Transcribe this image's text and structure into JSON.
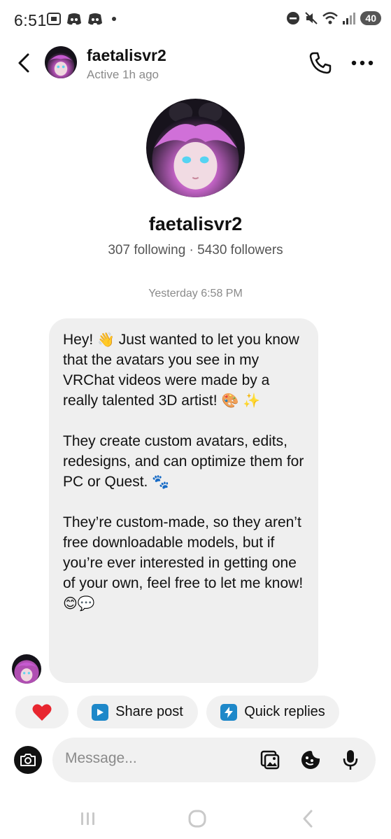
{
  "status_bar": {
    "time": "6:51",
    "battery": "40"
  },
  "header": {
    "username": "faetalisvr2",
    "active_status": "Active 1h ago"
  },
  "profile": {
    "username": "faetalisvr2",
    "stats": "307 following · 5430 followers"
  },
  "conversation": {
    "timestamp": "Yesterday 6:58 PM",
    "message": {
      "para1_a": "Hey! ",
      "para1_b": " Just wanted to let you know that the avatars you see in my VRChat videos were made by a really talented 3D artist! ",
      "para1_emoji_wave": "👋",
      "para1_emoji_palette": "🎨",
      "para1_emoji_sparkles": "✨",
      "para2": "They create custom avatars, edits, redesigns, and can optimize them for PC or Quest.",
      "para2_emoji_paws": "🐾",
      "para3": "They’re custom-made, so they aren’t free downloadable models, but if you’re ever interested in getting one of your own, feel free to let me know! ",
      "para3_emoji_smile": "😊",
      "para3_emoji_speech": "💬"
    }
  },
  "quick_actions": {
    "share_label": "Share post",
    "quick_replies_label": "Quick replies"
  },
  "composer": {
    "placeholder": "Message..."
  },
  "colors": {
    "accent_blue": "#1e88c9",
    "heart_red": "#e8262f",
    "bubble_bg": "#efefef"
  }
}
